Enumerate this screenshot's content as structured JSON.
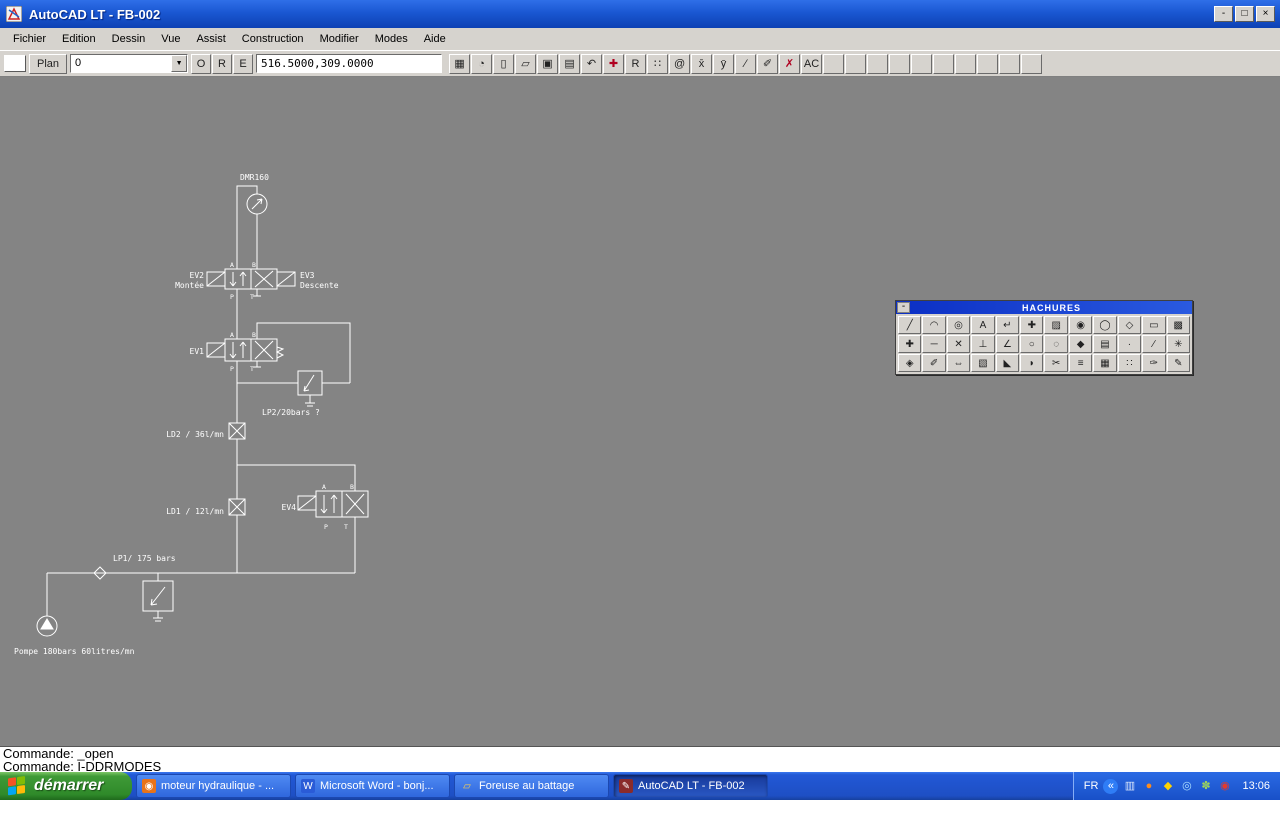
{
  "window": {
    "title": "AutoCAD LT - FB-002",
    "minimize_glyph": "-",
    "maximize_glyph": "□",
    "close_glyph": "×"
  },
  "menu": {
    "items": [
      "Fichier",
      "Edition",
      "Dessin",
      "Vue",
      "Assist",
      "Construction",
      "Modifier",
      "Modes",
      "Aide"
    ]
  },
  "toolbar": {
    "plan_label": "Plan",
    "layer_value": "0",
    "dropdown_arrow": "▼",
    "mode_buttons": [
      "O",
      "R",
      "E"
    ],
    "coords": "516.5000,309.0000",
    "empty_slots": 10,
    "icons": [
      {
        "name": "aerial-view-icon",
        "glyph": "▦"
      },
      {
        "name": "redraw-icon",
        "glyph": "◔"
      },
      {
        "name": "new-drawing-icon",
        "glyph": "▯"
      },
      {
        "name": "open-drawing-icon",
        "glyph": "▱"
      },
      {
        "name": "save-icon",
        "glyph": "▣"
      },
      {
        "name": "print-icon",
        "glyph": "▤"
      },
      {
        "name": "undo-icon",
        "glyph": "↶"
      },
      {
        "name": "zoom-window-icon",
        "glyph": "✚",
        "color": "#b00020"
      },
      {
        "name": "redo-icon",
        "glyph": "R"
      },
      {
        "name": "grid-snap-icon",
        "glyph": "∷"
      },
      {
        "name": "at-coordinate-icon",
        "glyph": "@"
      },
      {
        "name": "x-filter-icon",
        "glyph": "x̄"
      },
      {
        "name": "y-filter-icon",
        "glyph": "ȳ"
      },
      {
        "name": "angle-icon",
        "glyph": "∕"
      },
      {
        "name": "pencil-icon",
        "glyph": "✐"
      },
      {
        "name": "erase-icon",
        "glyph": "✗",
        "color": "#b00020"
      },
      {
        "name": "text-abc-icon",
        "glyph": "AC"
      }
    ]
  },
  "drawing": {
    "labels": {
      "motor": "DMR160",
      "ev2": "EV2",
      "ev2_sub": "Montée",
      "ev3": "EV3",
      "ev3_sub": "Descente",
      "ev1": "EV1",
      "lp2": "LP2/20bars ?",
      "ld2": "LD2 / 36l/mn",
      "ev4": "EV4",
      "ld1": "LD1 / 12l/mn",
      "lp1": "LP1/ 175 bars",
      "pump": "Pompe 180bars 60litres/mn",
      "port_a": "A",
      "port_b": "B",
      "port_p": "P",
      "port_t": "T"
    }
  },
  "palette": {
    "title": "HACHURES",
    "minimize_glyph": "-",
    "tools": [
      {
        "name": "line-hatch-icon",
        "glyph": "╱"
      },
      {
        "name": "arc-hatch-icon",
        "glyph": "◠"
      },
      {
        "name": "circle-hatch-icon",
        "glyph": "◎"
      },
      {
        "name": "text-hatch-icon",
        "glyph": "A"
      },
      {
        "name": "leader-icon",
        "glyph": "↵"
      },
      {
        "name": "point-icon",
        "glyph": "✚"
      },
      {
        "name": "solid-hatch-icon",
        "glyph": "▨"
      },
      {
        "name": "donut-icon",
        "glyph": "◉"
      },
      {
        "name": "ellipse-icon",
        "glyph": "◯"
      },
      {
        "name": "polygon-icon",
        "glyph": "◇"
      },
      {
        "name": "rectangle-icon",
        "glyph": "▭"
      },
      {
        "name": "diagonal-hatch-icon",
        "glyph": "▩"
      },
      {
        "name": "plus-icon",
        "glyph": "✚"
      },
      {
        "name": "horizontal-line-icon",
        "glyph": "─"
      },
      {
        "name": "cross-icon",
        "glyph": "✕"
      },
      {
        "name": "perpendicular-icon",
        "glyph": "⊥"
      },
      {
        "name": "angle-tool-icon",
        "glyph": "∠"
      },
      {
        "name": "small-circle-icon",
        "glyph": "○"
      },
      {
        "name": "region-icon",
        "glyph": "◌"
      },
      {
        "name": "diamond-icon",
        "glyph": "◆"
      },
      {
        "name": "dim-box-icon",
        "glyph": "▤"
      },
      {
        "name": "dot-icon",
        "glyph": "·"
      },
      {
        "name": "slash-icon",
        "glyph": "∕"
      },
      {
        "name": "star-icon",
        "glyph": "✳"
      },
      {
        "name": "layers-icon",
        "glyph": "◈"
      },
      {
        "name": "eraser-icon",
        "glyph": "✐"
      },
      {
        "name": "stretch-icon",
        "glyph": "⇔"
      },
      {
        "name": "snap-box-icon",
        "glyph": "▧"
      },
      {
        "name": "chamfer-icon",
        "glyph": "◣"
      },
      {
        "name": "oval-icon",
        "glyph": "◗"
      },
      {
        "name": "trim-icon",
        "glyph": "✂"
      },
      {
        "name": "list-icon",
        "glyph": "≡"
      },
      {
        "name": "grid-box-icon",
        "glyph": "▦"
      },
      {
        "name": "array-icon",
        "glyph": "∷"
      },
      {
        "name": "paint-icon",
        "glyph": "✑"
      },
      {
        "name": "edit-icon",
        "glyph": "✎"
      }
    ]
  },
  "command": {
    "line1": "Commande: _open",
    "line2": "Commande: I-DDRMODES"
  },
  "taskbar": {
    "start_label": "démarrer",
    "tasks": [
      {
        "label": "moteur hydraulique - ...",
        "active": false,
        "icon": {
          "name": "browser-page-icon",
          "glyph": "◉",
          "color": "#ffffff",
          "bg": "#e8731a"
        }
      },
      {
        "label": "Microsoft Word - bonj...",
        "active": false,
        "icon": {
          "name": "word-icon",
          "glyph": "W",
          "color": "#ffffff",
          "bg": "#2a5bd7"
        }
      },
      {
        "label": "Foreuse au battage",
        "active": false,
        "icon": {
          "name": "folder-icon",
          "glyph": "▱",
          "color": "#ffd34f",
          "bg": "transparent"
        }
      },
      {
        "label": "AutoCAD LT - FB-002",
        "active": true,
        "icon": {
          "name": "autocad-task-icon",
          "glyph": "✎",
          "color": "#ffffff",
          "bg": "#8a2b2b"
        }
      }
    ],
    "tray": {
      "language": "FR",
      "icons": [
        {
          "name": "hide-icons-chevron-icon",
          "glyph": "«",
          "color": "#ffffff",
          "bg": "#2f7df6"
        },
        {
          "name": "display-tray-icon",
          "glyph": "▥",
          "color": "#d9e6fb"
        },
        {
          "name": "network-tray-icon",
          "glyph": "●",
          "color": "#ff8c1a"
        },
        {
          "name": "antivirus-tray-icon",
          "glyph": "◆",
          "color": "#ffd300"
        },
        {
          "name": "messenger-tray-icon",
          "glyph": "◎",
          "color": "#aee0ff"
        },
        {
          "name": "volume-tray-icon",
          "glyph": "✽",
          "color": "#9fd65a"
        },
        {
          "name": "update-tray-icon",
          "glyph": "◉",
          "color": "#e23a2e"
        }
      ],
      "clock": "13:06"
    }
  }
}
